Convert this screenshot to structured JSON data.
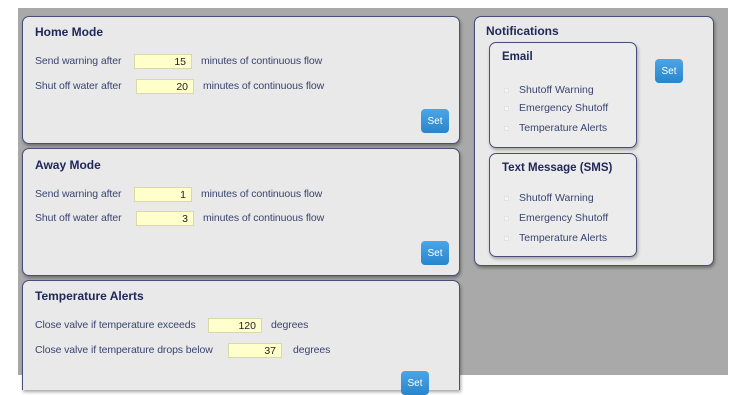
{
  "home_mode": {
    "title": "Home Mode",
    "warning_label": "Send warning after",
    "warning_value": "15",
    "warning_suffix": "minutes of continuous flow",
    "shutoff_label": "Shut off water after",
    "shutoff_value": "20",
    "shutoff_suffix": "minutes of continuous flow",
    "set_label": "Set"
  },
  "away_mode": {
    "title": "Away Mode",
    "warning_label": "Send warning after",
    "warning_value": "1",
    "warning_suffix": "minutes of continuous flow",
    "shutoff_label": "Shut off water after",
    "shutoff_value": "3",
    "shutoff_suffix": "minutes of continuous flow",
    "set_label": "Set"
  },
  "temperature_alerts": {
    "title": "Temperature Alerts",
    "exceeds_label": "Close valve if temperature exceeds",
    "exceeds_value": "120",
    "exceeds_suffix": "degrees",
    "below_label": "Close valve if temperature drops below",
    "below_value": "37",
    "below_suffix": "degrees",
    "set_label": "Set"
  },
  "notifications": {
    "title": "Notifications",
    "set_label": "Set",
    "email": {
      "title": "Email",
      "options": [
        "Shutoff Warning",
        "Emergency Shutoff",
        "Temperature Alerts"
      ]
    },
    "sms": {
      "title": "Text Message (SMS)",
      "options": [
        "Shutoff Warning",
        "Emergency Shutoff",
        "Temperature Alerts"
      ]
    }
  },
  "colors": {
    "panel_border": "#4a4d78",
    "title_text": "#20275a",
    "body_text": "#3a4470",
    "input_bg": "#ffffcc",
    "button": "#3a96d8",
    "backdrop": "#a9a9a9"
  }
}
